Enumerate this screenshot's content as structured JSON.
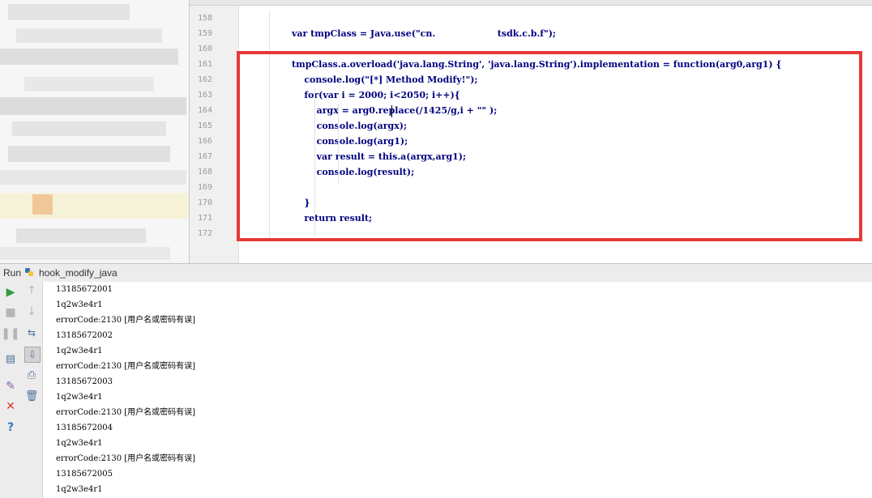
{
  "editor": {
    "line_numbers": [
      "158",
      "159",
      "160",
      "161",
      "162",
      "163",
      "164",
      "165",
      "166",
      "167",
      "168",
      "169",
      "170",
      "171",
      "172"
    ],
    "lines": [
      {
        "n": "158",
        "text": ""
      },
      {
        "n": "159",
        "text": "var tmpClass = Java.use(\"cn.                    tsdk.c.b.f\");"
      },
      {
        "n": "160",
        "text": ""
      },
      {
        "n": "161",
        "text": "tmpClass.a.overload('java.lang.String', 'java.lang.String').implementation = function(arg0,arg1) {"
      },
      {
        "n": "162",
        "text": "    console.log(\"[*] Method Modify!\");"
      },
      {
        "n": "163",
        "text": "    for(var i = 2000; i<2050; i++){"
      },
      {
        "n": "164",
        "text": "        argx = arg0.replace(/1425/g,i + \"\" );"
      },
      {
        "n": "165",
        "text": "        console.log(argx);"
      },
      {
        "n": "166",
        "text": "        console.log(arg1);"
      },
      {
        "n": "167",
        "text": "        var result = this.a(argx,arg1);"
      },
      {
        "n": "168",
        "text": "        console.log(result);"
      },
      {
        "n": "169",
        "text": ""
      },
      {
        "n": "170",
        "text": "    }"
      },
      {
        "n": "171",
        "text": "    return result;"
      },
      {
        "n": "172",
        "text": ""
      }
    ]
  },
  "run": {
    "label": "Run",
    "config_name": "hook_modify_java"
  },
  "console": {
    "lines": [
      "13185672001",
      "1q2w3e4r1",
      "errorCode:2130 [用户名或密码有误]",
      "13185672002",
      "1q2w3e4r1",
      "errorCode:2130 [用户名或密码有误]",
      "13185672003",
      "1q2w3e4r1",
      "errorCode:2130 [用户名或密码有误]",
      "13185672004",
      "1q2w3e4r1",
      "errorCode:2130 [用户名或密码有误]",
      "13185672005",
      "1q2w3e4r1"
    ]
  },
  "icons": {
    "run": "play-icon",
    "stop": "stop-icon",
    "pause": "pause-icon",
    "layout": "layout-icon",
    "pin": "pin-icon",
    "close": "close-icon",
    "help": "help-icon",
    "up": "up-arrow-icon",
    "down": "down-arrow-icon",
    "wrap": "soft-wrap-icon",
    "scroll": "scroll-to-end-icon",
    "print": "print-icon",
    "trash": "trash-icon"
  },
  "colors": {
    "highlight_box": "#e53935",
    "code_keyword": "#000080",
    "code_string": "#008000"
  }
}
